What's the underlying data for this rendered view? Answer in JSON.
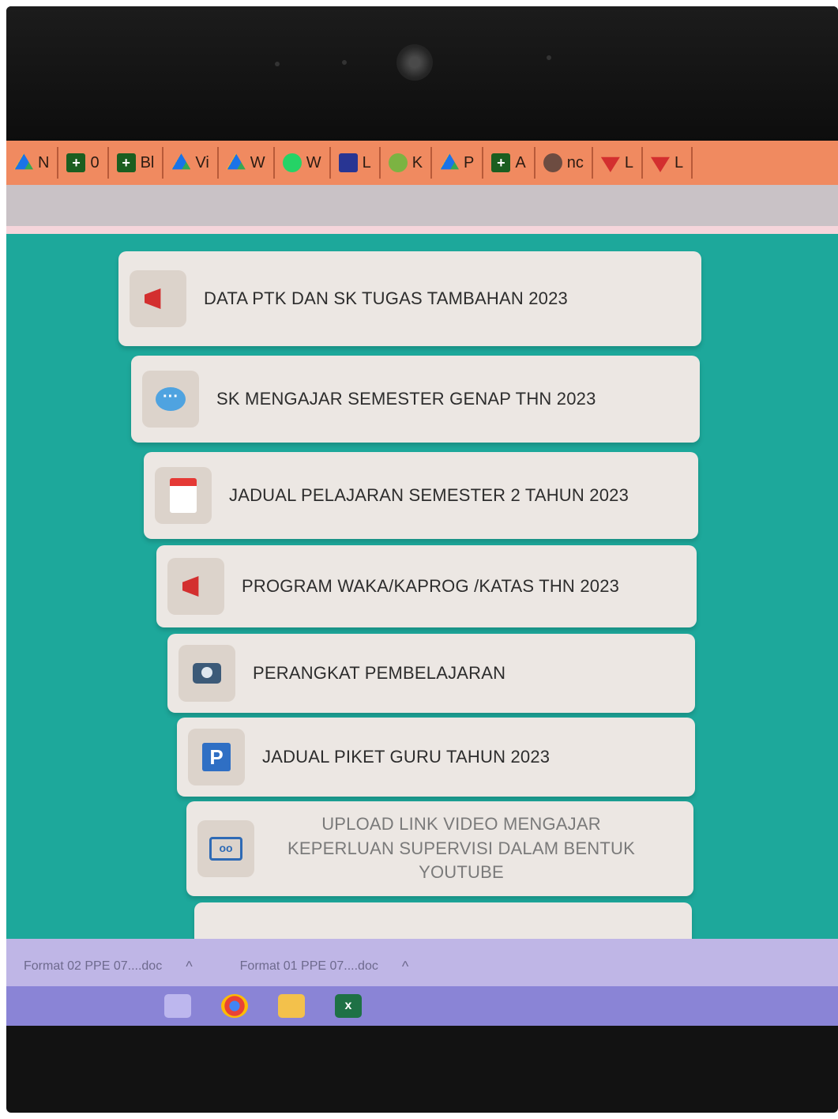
{
  "bookmarks": [
    {
      "label": "N",
      "icon": "google-drive-icon"
    },
    {
      "label": "0",
      "icon": "green-cross-icon"
    },
    {
      "label": "Bl",
      "icon": "green-cross-icon"
    },
    {
      "label": "Vi",
      "icon": "google-drive-icon"
    },
    {
      "label": "W",
      "icon": "google-drive-icon"
    },
    {
      "label": "W",
      "icon": "whatsapp-icon"
    },
    {
      "label": "L",
      "icon": "list-icon"
    },
    {
      "label": "K",
      "icon": "green-star-icon"
    },
    {
      "label": "P",
      "icon": "google-drive-icon"
    },
    {
      "label": "A",
      "icon": "green-cross-icon"
    },
    {
      "label": "nc",
      "icon": "shield-icon"
    },
    {
      "label": "L",
      "icon": "wifi-icon"
    },
    {
      "label": "L",
      "icon": "wifi-icon"
    }
  ],
  "menu": {
    "items": [
      {
        "label": "DATA PTK DAN SK TUGAS TAMBAHAN 2023",
        "icon": "megaphone-icon"
      },
      {
        "label": "SK MENGAJAR SEMESTER GENAP THN 2023",
        "icon": "chat-bubble-icon"
      },
      {
        "label": "JADUAL PELAJARAN SEMESTER 2 TAHUN 2023",
        "icon": "calendar-icon"
      },
      {
        "label": "PROGRAM WAKA/KAPROG /KATAS THN 2023",
        "icon": "megaphone-icon"
      },
      {
        "label": "PERANGKAT PEMBELAJARAN",
        "icon": "camera-icon"
      },
      {
        "label": "JADUAL PIKET GURU TAHUN 2023",
        "icon": "parking-icon"
      },
      {
        "label": "UPLOAD LINK VIDEO MENGAJAR KEPERLUAN SUPERVISI DALAM BENTUK YOUTUBE",
        "icon": "cassette-icon"
      }
    ]
  },
  "downloads": [
    {
      "label": "Format 02 PPE 07....doc"
    },
    {
      "label": "Format 01 PPE 07....doc"
    }
  ],
  "taskbar": {
    "excel_label": "x"
  },
  "colors": {
    "screen_bg": "#1da89b",
    "bookmark_bar": "#f08a60",
    "card_bg": "#ece7e3",
    "taskbar": "#8a84d6"
  }
}
